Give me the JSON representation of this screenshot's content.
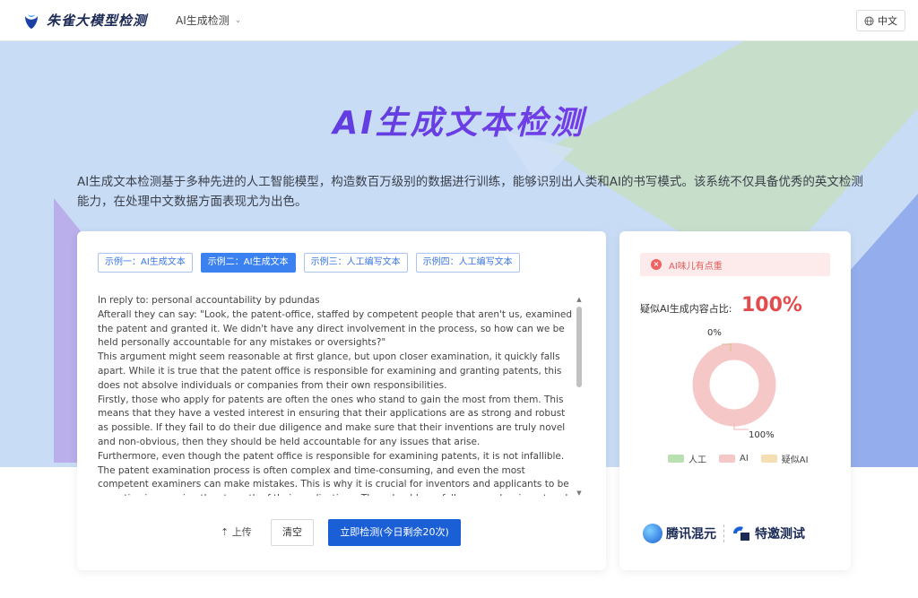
{
  "header": {
    "brand": "朱雀大模型检测",
    "nav_label": "AI生成检测",
    "lang_label": "中文"
  },
  "colors": {
    "hero_bg": "#c9dcf6",
    "primary": "#1b5fd6",
    "tab_active": "#3b82f0",
    "alert_text": "#e25c5c",
    "human": "#b8e0b0",
    "ai": "#f6c7c7",
    "suspect_ai": "#f5dfb2"
  },
  "hero": {
    "title": "AI生成文本检测",
    "intro": "AI生成文本检测基于多种先进的人工智能模型，构造数百万级别的数据进行训练，能够识别出人类和AI的书写模式。该系统不仅具备优秀的英文检测能力，在处理中文数据方面表现尤为出色。"
  },
  "editor": {
    "tabs": [
      {
        "label": "示例一：AI生成文本",
        "active": false
      },
      {
        "label": "示例二：AI生成文本",
        "active": true
      },
      {
        "label": "示例三：人工编写文本",
        "active": false
      },
      {
        "label": "示例四：人工编写文本",
        "active": false
      }
    ],
    "paragraphs": [
      "In reply to: personal accountability by pdundas",
      "Afterall they can say: \"Look, the patent-office, staffed by competent people that aren't us, examined the patent and granted it. We didn't have any direct involvement in the process, so how can we be held personally accountable for any mistakes or oversights?\"",
      "This argument might seem reasonable at first glance, but upon closer examination, it quickly falls apart. While it is true that the patent office is responsible for examining and granting patents, this does not absolve individuals or companies from their own responsibilities.",
      "Firstly, those who apply for patents are often the ones who stand to gain the most from them. This means that they have a vested interest in ensuring that their applications are as strong and robust as possible. If they fail to do their due diligence and make sure that their inventions are truly novel and non-obvious, then they should be held accountable for any issues that arise.",
      "Furthermore, even though the patent office is responsible for examining patents, it is not infallible. The patent examination process is often complex and time-consuming, and even the most competent examiners can make mistakes. This is why it is crucial for inventors and applicants to be proactive in ensuring the strength of their applications. They should carefully research prior art and ensure their"
    ],
    "upload_label": "上传",
    "clear_label": "清空",
    "detect_label": "立即检测(今日剩余20次)"
  },
  "result": {
    "alert": "AI味儿有点重",
    "ratio_label": "疑似AI生成内容占比:",
    "ratio_value": "100%",
    "donut_top_label": "0%",
    "donut_bottom_label": "100%"
  },
  "chart_data": {
    "type": "pie",
    "categories": [
      "人工",
      "AI",
      "疑似AI"
    ],
    "values": [
      0,
      100,
      0
    ],
    "legend_position": "bottom"
  },
  "partners": {
    "hunyuan": "腾讯混元",
    "special": "特邀测试"
  }
}
